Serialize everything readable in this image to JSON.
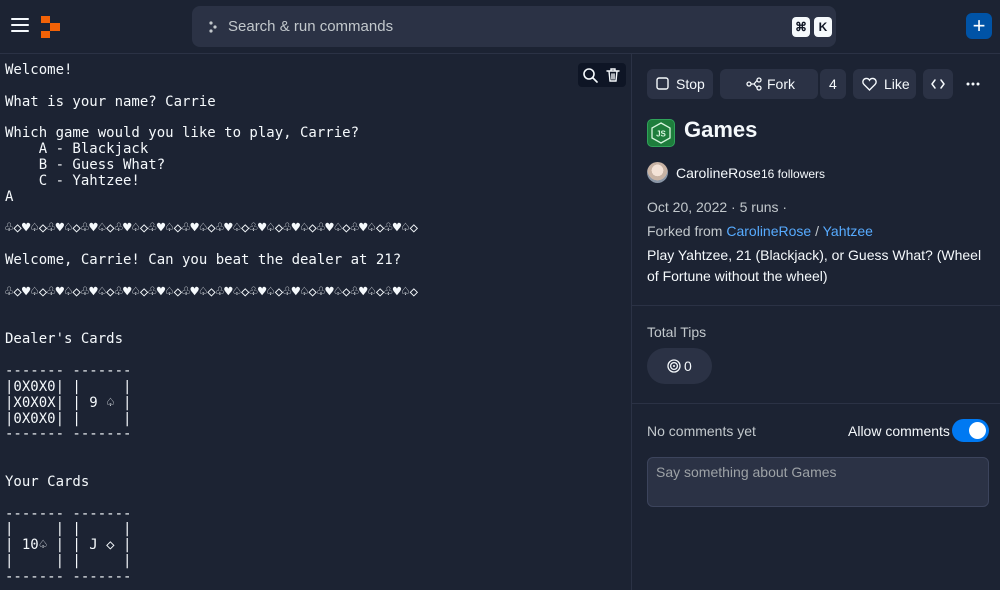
{
  "topbar": {
    "search_placeholder": "Search & run commands",
    "shortcut_key1": "⌘",
    "shortcut_key2": "K",
    "add_label": "+"
  },
  "console": {
    "output": "Welcome!\n\nWhat is your name? Carrie\n\nWhich game would you like to play, Carrie?\n    A - Blackjack\n    B - Guess What?\n    C - Yahtzee!\nA\n\n♧◇♥♤◇♧♥♤◇♧♥♤◇♧♥♤◇♧♥♤◇♧♥♤◇♧♥♤◇♧♥♤◇♧♥♤◇♧♥♤◇♧♥♤◇♧♥♤◇\n\nWelcome, Carrie! Can you beat the dealer at 21?\n\n♧◇♥♤◇♧♥♤◇♧♥♤◇♧♥♤◇♧♥♤◇♧♥♤◇♧♥♤◇♧♥♤◇♧♥♤◇♧♥♤◇♧♥♤◇♧♥♤◇\n\n\nDealer's Cards\n\n------- -------\n|0X0X0| |     |\n|X0X0X| | 9 ♤ |\n|0X0X0| |     |\n------- -------\n\n\nYour Cards\n\n------- -------\n|     | |     |\n| 10♤ | | J ◇ |\n|     | |     |\n------- -------"
  },
  "actions": {
    "stop_label": "Stop",
    "fork_label": "Fork",
    "fork_count": "4",
    "like_label": "Like"
  },
  "repl": {
    "title": "Games",
    "author": "CarolineRose",
    "followers": "16 followers",
    "date": "Oct 20, 2022",
    "runs": "5 runs",
    "meta_sep": " · ",
    "meta_trail": " ·",
    "forked_prefix": "Forked from ",
    "forked_user": "CarolineRose",
    "forked_sep": " / ",
    "forked_repl": "Yahtzee",
    "description": "Play Yahtzee, 21 (Blackjack), or Guess What? (Wheel of Fortune without the wheel)"
  },
  "tips": {
    "label": "Total Tips",
    "value": "0"
  },
  "comments": {
    "status": "No comments yet",
    "allow_label": "Allow comments",
    "allow_enabled": true,
    "placeholder": "Say something about Games"
  },
  "colors": {
    "background": "#0e1525",
    "surface": "#1c2333",
    "control": "#2b3245",
    "link": "#57abff",
    "toggle_on": "#0079f2",
    "brand": "#f26207"
  }
}
